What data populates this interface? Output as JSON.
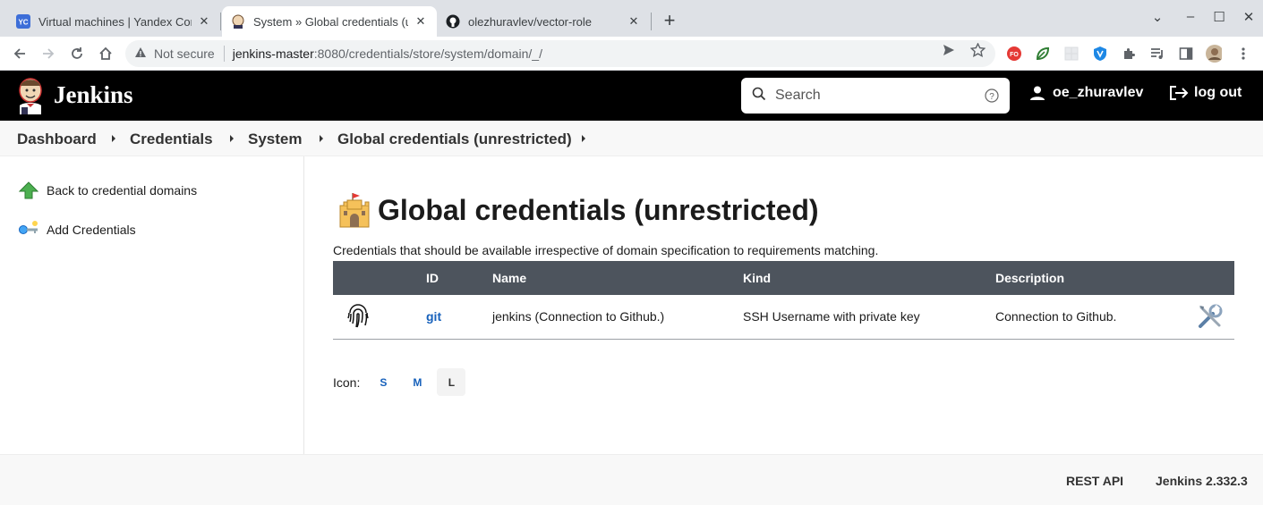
{
  "browser": {
    "tabs": [
      {
        "title": "Virtual machines | Yandex Com",
        "favicon": "yc-icon",
        "active": false
      },
      {
        "title": "System » Global credentials (u",
        "favicon": "jenkins-icon",
        "active": true
      },
      {
        "title": "olezhuravlev/vector-role",
        "favicon": "github-icon",
        "active": false
      }
    ],
    "new_tab_label": "+",
    "address": {
      "security_label": "Not secure",
      "host": "jenkins-master",
      "path": ":8080/credentials/store/system/domain/_/"
    },
    "extensions": [
      "fo-extension-icon",
      "leaf-extension-icon",
      "grid-extension-icon",
      "shield-extension-icon",
      "puzzle-icon",
      "media-icon",
      "sidepanel-icon",
      "avatar-icon"
    ]
  },
  "header": {
    "app_name": "Jenkins",
    "search_placeholder": "Search",
    "username": "oe_zhuravlev",
    "logout_label": "log out"
  },
  "breadcrumbs": [
    "Dashboard",
    "Credentials",
    "System",
    "Global credentials (unrestricted)"
  ],
  "sidebar": {
    "items": [
      {
        "label": "Back to credential domains",
        "icon": "up-arrow-icon"
      },
      {
        "label": "Add Credentials",
        "icon": "key-icon"
      }
    ]
  },
  "main": {
    "title": "Global credentials (unrestricted)",
    "description": "Credentials that should be available irrespective of domain specification to requirements matching.",
    "table": {
      "headers": [
        "",
        "ID",
        "Name",
        "Kind",
        "Description",
        ""
      ],
      "rows": [
        {
          "id": "git",
          "name": "jenkins (Connection to Github.)",
          "kind": "SSH Username with private key",
          "description": "Connection to Github."
        }
      ]
    },
    "icon_size": {
      "label": "Icon:",
      "options": [
        "S",
        "M",
        "L"
      ],
      "selected": "L"
    }
  },
  "footer": {
    "rest_api": "REST API",
    "version": "Jenkins 2.332.3"
  }
}
